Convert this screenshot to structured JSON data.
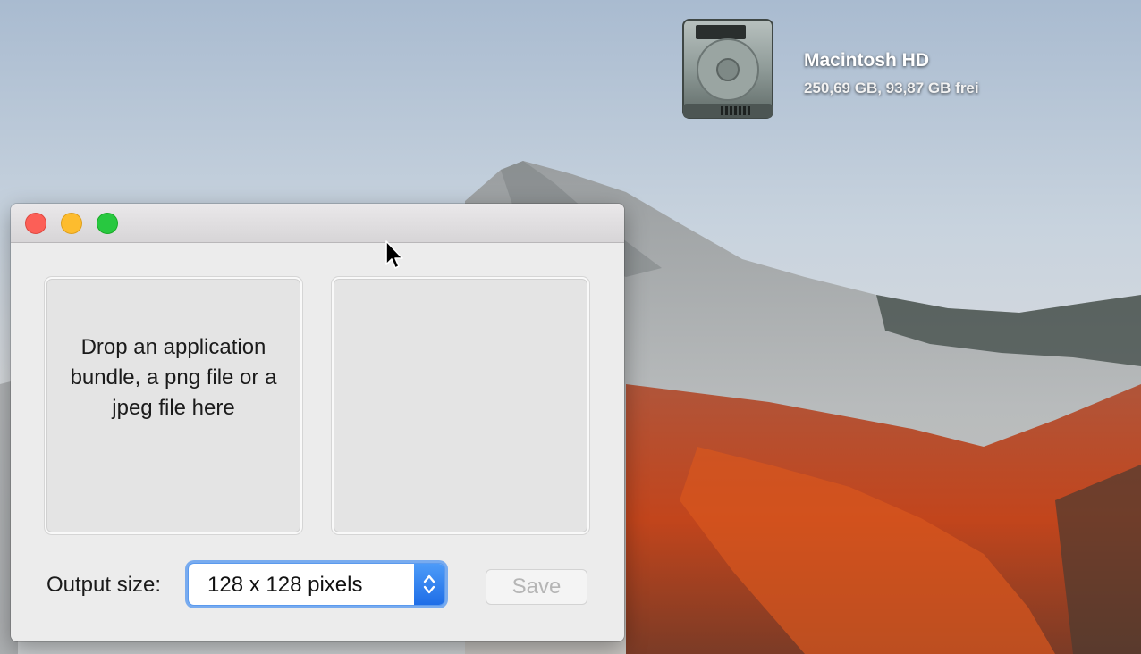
{
  "desktop": {
    "disk": {
      "name": "Macintosh HD",
      "info": "250,69 GB, 93,87 GB frei",
      "icon": "hard-drive-icon"
    }
  },
  "window": {
    "drop_area": {
      "text": "Drop an application bundle, a png file or a jpeg file here"
    },
    "output_size_label": "Output size:",
    "output_size_select": {
      "value": "128 x 128 pixels"
    },
    "save_label": "Save"
  },
  "colors": {
    "close": "#fc5f57",
    "minimize": "#fdbc2e",
    "zoom": "#28c840",
    "accent": "#1f6ee7"
  }
}
